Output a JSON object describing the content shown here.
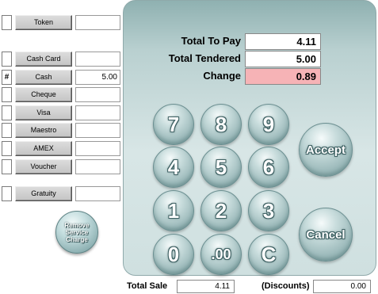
{
  "payment_methods": [
    {
      "label": "Token",
      "marker": "",
      "amount": ""
    },
    {
      "label": "Cash Card",
      "marker": "",
      "amount": ""
    },
    {
      "label": "Cash",
      "marker": "#",
      "amount": "5.00"
    },
    {
      "label": "Cheque",
      "marker": "",
      "amount": ""
    },
    {
      "label": "Visa",
      "marker": "",
      "amount": ""
    },
    {
      "label": "Maestro",
      "marker": "",
      "amount": ""
    },
    {
      "label": "AMEX",
      "marker": "",
      "amount": ""
    },
    {
      "label": "Voucher",
      "marker": "",
      "amount": ""
    },
    {
      "label": "Gratuity",
      "marker": "",
      "amount": ""
    }
  ],
  "remove_service": {
    "line1": "Remove",
    "line2": "Service",
    "line3": "Charge"
  },
  "totals": {
    "to_pay_label": "Total To Pay",
    "to_pay_value": "4.11",
    "tendered_label": "Total Tendered",
    "tendered_value": "5.00",
    "change_label": "Change",
    "change_value": "0.89"
  },
  "keypad": {
    "k7": "7",
    "k8": "8",
    "k9": "9",
    "k4": "4",
    "k5": "5",
    "k6": "6",
    "k1": "1",
    "k2": "2",
    "k3": "3",
    "k0": "0",
    "kdz": ".00",
    "kc": "C",
    "accept": "Accept",
    "cancel": "Cancel"
  },
  "footer": {
    "total_sale_label": "Total Sale",
    "total_sale_value": "4.11",
    "discounts_label": "(Discounts)",
    "discounts_value": "0.00"
  },
  "colors": {
    "change_bg": "#f6b3b6",
    "panel": "#c9dcdc",
    "key": "#9ab8b9"
  }
}
